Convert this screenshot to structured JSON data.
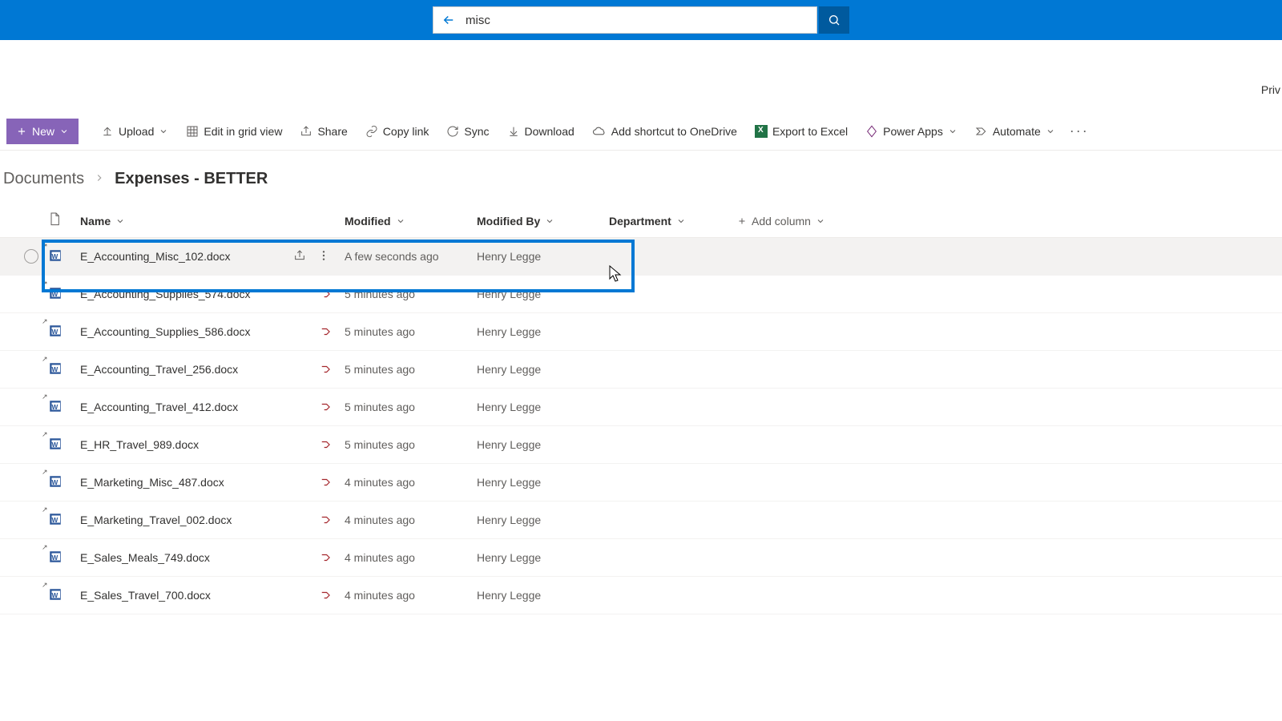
{
  "search": {
    "value": "misc"
  },
  "priv_label": "Priv",
  "toolbar": {
    "new": "New",
    "upload": "Upload",
    "edit_grid": "Edit in grid view",
    "share": "Share",
    "copy_link": "Copy link",
    "sync": "Sync",
    "download": "Download",
    "add_shortcut": "Add shortcut to OneDrive",
    "export_excel": "Export to Excel",
    "power_apps": "Power Apps",
    "automate": "Automate"
  },
  "breadcrumb": {
    "parent": "Documents",
    "current": "Expenses - BETTER"
  },
  "columns": {
    "name": "Name",
    "modified": "Modified",
    "modified_by": "Modified By",
    "department": "Department",
    "add_column": "Add column"
  },
  "rows": [
    {
      "name": "E_Accounting_Misc_102.docx",
      "modified": "A few seconds ago",
      "modified_by": "Henry Legge",
      "flow": false,
      "hovered": true
    },
    {
      "name": "E_Accounting_Supplies_574.docx",
      "modified": "5 minutes ago",
      "modified_by": "Henry Legge",
      "flow": true,
      "hovered": false
    },
    {
      "name": "E_Accounting_Supplies_586.docx",
      "modified": "5 minutes ago",
      "modified_by": "Henry Legge",
      "flow": true,
      "hovered": false
    },
    {
      "name": "E_Accounting_Travel_256.docx",
      "modified": "5 minutes ago",
      "modified_by": "Henry Legge",
      "flow": true,
      "hovered": false
    },
    {
      "name": "E_Accounting_Travel_412.docx",
      "modified": "5 minutes ago",
      "modified_by": "Henry Legge",
      "flow": true,
      "hovered": false
    },
    {
      "name": "E_HR_Travel_989.docx",
      "modified": "5 minutes ago",
      "modified_by": "Henry Legge",
      "flow": true,
      "hovered": false
    },
    {
      "name": "E_Marketing_Misc_487.docx",
      "modified": "4 minutes ago",
      "modified_by": "Henry Legge",
      "flow": true,
      "hovered": false
    },
    {
      "name": "E_Marketing_Travel_002.docx",
      "modified": "4 minutes ago",
      "modified_by": "Henry Legge",
      "flow": true,
      "hovered": false
    },
    {
      "name": "E_Sales_Meals_749.docx",
      "modified": "4 minutes ago",
      "modified_by": "Henry Legge",
      "flow": true,
      "hovered": false
    },
    {
      "name": "E_Sales_Travel_700.docx",
      "modified": "4 minutes ago",
      "modified_by": "Henry Legge",
      "flow": true,
      "hovered": false
    }
  ]
}
